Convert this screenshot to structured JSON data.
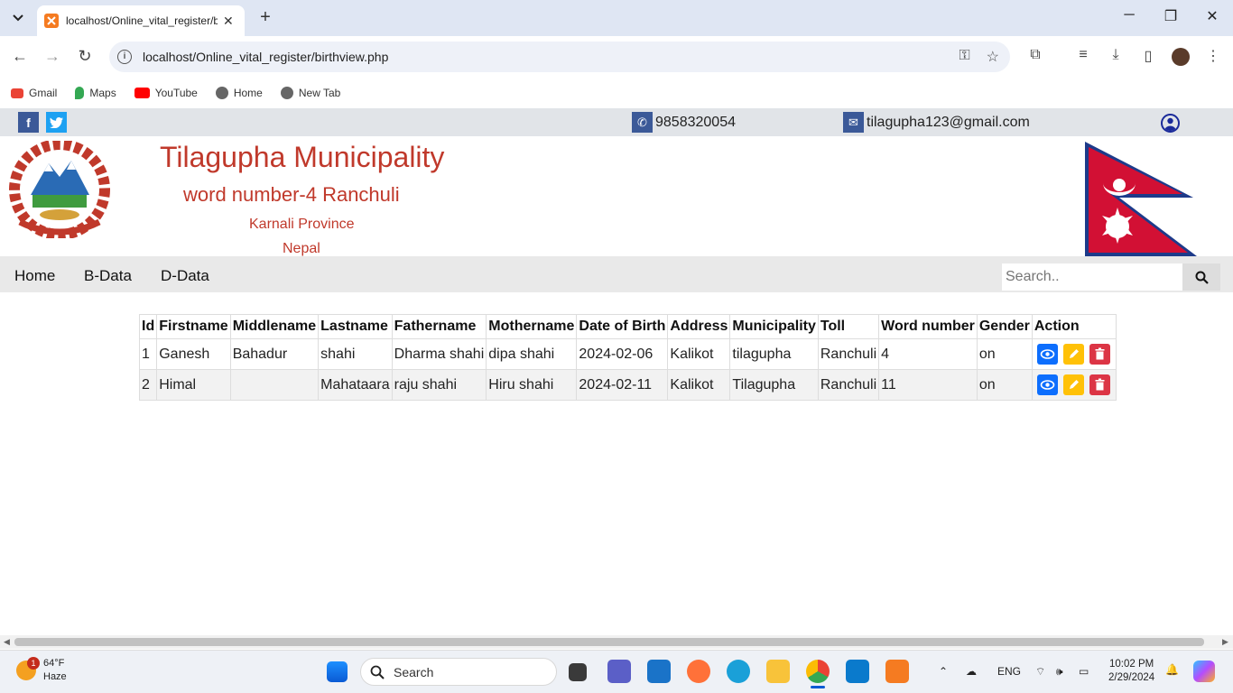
{
  "browser": {
    "tab_title": "localhost/Online_vital_register/b",
    "url": "localhost/Online_vital_register/birthview.php",
    "bookmarks": [
      "Gmail",
      "Maps",
      "YouTube",
      "Home",
      "New Tab"
    ]
  },
  "topbar": {
    "phone": "9858320054",
    "email": "tilagupha123@gmail.com",
    "facebook": "f",
    "twitter": "t"
  },
  "header": {
    "title": "Tilagupha Municipality",
    "subtitle": "word number-4 Ranchuli",
    "province": "Karnali Province",
    "country": "Nepal"
  },
  "menu": {
    "items": [
      "Home",
      "B-Data",
      "D-Data"
    ],
    "search_placeholder": "Search.."
  },
  "table": {
    "headers": [
      "Id",
      "Firstname",
      "Middlename",
      "Lastname",
      "Fathername",
      "Mothername",
      "Date of Birth",
      "Address",
      "Municipality",
      "Toll",
      "Word number",
      "Gender",
      "Action"
    ],
    "rows": [
      [
        "1",
        "Ganesh",
        "Bahadur",
        "shahi",
        "Dharma shahi",
        "dipa shahi",
        "2024-02-06",
        "Kalikot",
        "tilagupha",
        "Ranchuli",
        "4",
        "on"
      ],
      [
        "2",
        "Himal",
        "",
        "Mahataara",
        "raju shahi",
        "Hiru shahi",
        "2024-02-11",
        "Kalikot",
        "Tilagupha",
        "Ranchuli",
        "11",
        "on"
      ]
    ]
  },
  "taskbar": {
    "weather_temp": "64°F",
    "weather_desc": "Haze",
    "weather_badge": "1",
    "search_label": "Search",
    "lang": "ENG",
    "time": "10:02 PM",
    "date": "2/29/2024"
  },
  "colors": {
    "accent_red": "#c0392b",
    "view": "#0d6efd",
    "edit": "#ffc107",
    "delete": "#dc3545"
  }
}
